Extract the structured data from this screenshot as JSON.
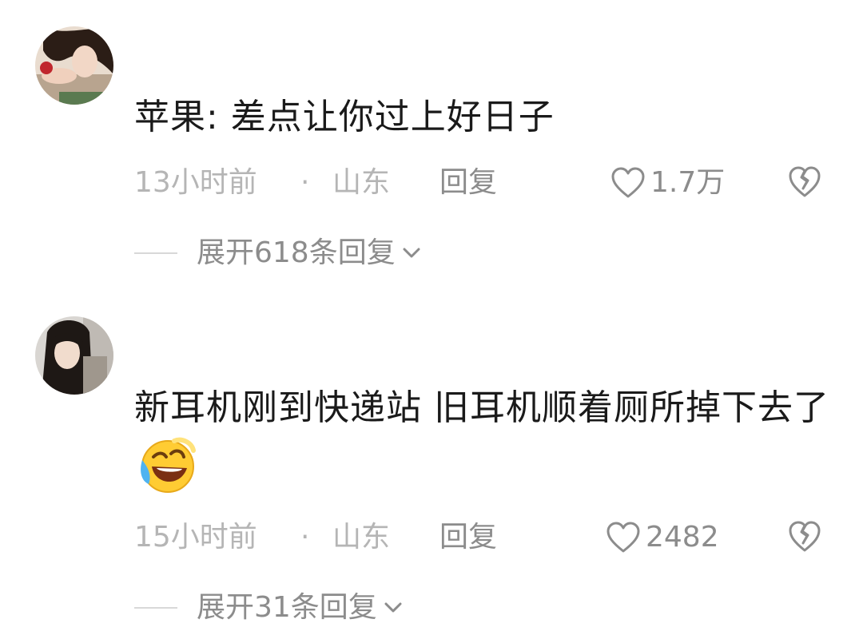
{
  "comments": [
    {
      "username": "",
      "text": "苹果: 差点让你过上好日子",
      "emoji_icon": "",
      "time": "13小时前",
      "separator": "·",
      "location": "山东",
      "reply_label": "回复",
      "likes": "1.7万",
      "expand_label": "展开618条回复"
    },
    {
      "username": "",
      "text": "新耳机刚到快递站 旧耳机顺着厕所掉下去了",
      "emoji_icon": "laughing-crying-emoji",
      "time": "15小时前",
      "separator": "·",
      "location": "山东",
      "reply_label": "回复",
      "likes": "2482",
      "expand_label": "展开31条回复"
    }
  ],
  "colors": {
    "text": "#1a1a1a",
    "meta_light": "#b5b5b5",
    "meta_dark": "#8c8c8c"
  }
}
